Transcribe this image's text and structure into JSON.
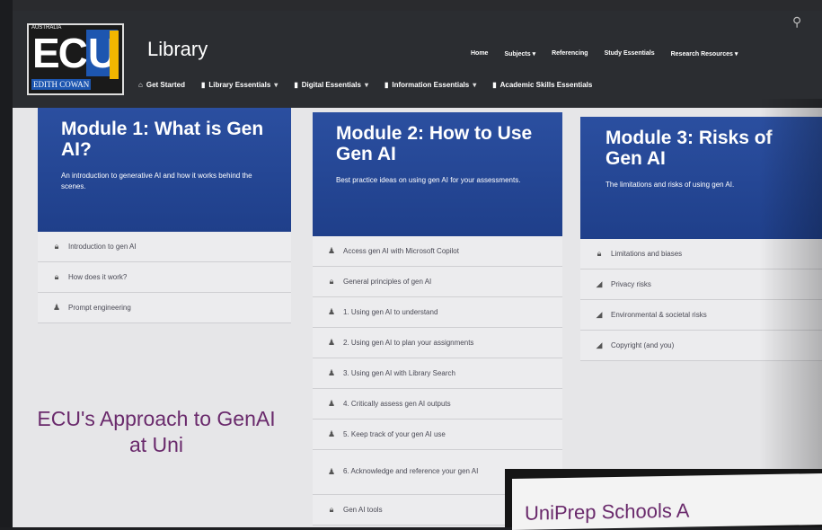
{
  "header": {
    "logo_text": "ECU",
    "logo_tagline": "EDITH COWAN",
    "logo_top": "AUSTRALIA",
    "logo_side": "UNIVERSITY",
    "title": "Library",
    "topnav": [
      "Home",
      "Subjects",
      "Referencing",
      "Study Essentials",
      "Research Resources"
    ],
    "subnav": [
      {
        "label": "Get Started",
        "icon": "home-icon"
      },
      {
        "label": "Library Essentials",
        "icon": "page-icon"
      },
      {
        "label": "Digital Essentials",
        "icon": "page-icon"
      },
      {
        "label": "Information Essentials",
        "icon": "page-icon"
      },
      {
        "label": "Academic Skills Essentials",
        "icon": "page-icon"
      }
    ]
  },
  "modules": [
    {
      "title": "Module 1: What is Gen AI?",
      "description": "An introduction to generative AI and how it works behind the scenes.",
      "items": [
        "Introduction to gen AI",
        "How does it work?",
        "Prompt engineering"
      ]
    },
    {
      "title": "Module 2: How to Use Gen AI",
      "description": "Best practice ideas on using gen AI for your assessments.",
      "items": [
        "Access gen AI with Microsoft Copilot",
        "General principles of gen AI",
        "1. Using gen AI to understand",
        "2. Using gen AI to plan your assignments",
        "3. Using gen AI with Library Search",
        "4. Critically assess gen AI outputs",
        "5. Keep track of your gen AI use",
        "6. Acknowledge and reference your gen AI",
        "Gen AI tools"
      ]
    },
    {
      "title": "Module 3: Risks of Gen AI",
      "description": "The limitations and risks of using gen AI.",
      "items": [
        "Limitations and biases",
        "Privacy risks",
        "Environmental & societal risks",
        "Copyright (and you)"
      ]
    }
  ],
  "approach_text": "ECU's Approach to GenAI at Uni",
  "overlay_text": "UniPrep Schools A"
}
